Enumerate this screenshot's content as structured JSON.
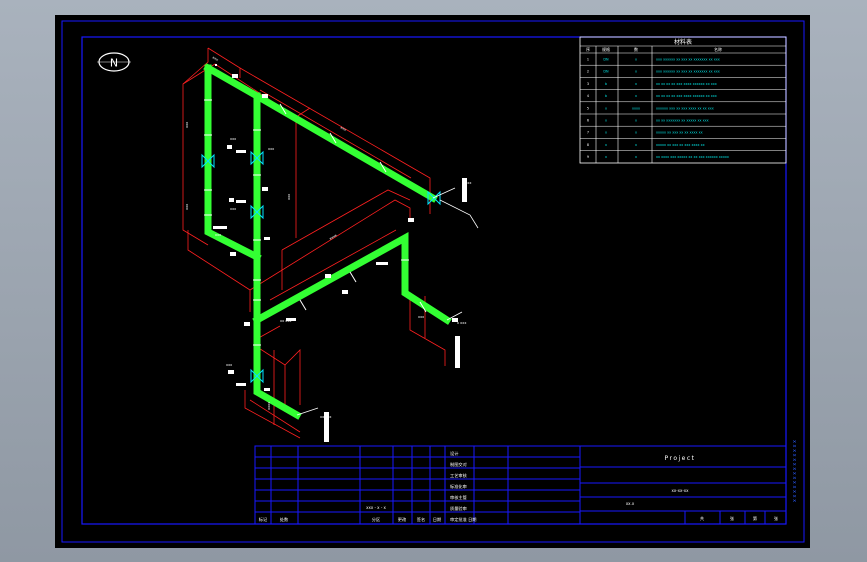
{
  "north_label": "N",
  "colors": {
    "background": "#000000",
    "frame": "#1818ff",
    "pipe": "#33ff33",
    "dimension": "#ff2020",
    "text": "#ffffff",
    "table_text": "#00e5e5",
    "annotation": "#ffffff"
  },
  "parts_table": {
    "title": "材料表",
    "headers": [
      "序",
      "规格",
      "数",
      "名称"
    ],
    "rows": [
      [
        "1",
        "DN",
        "x",
        "xxx xxxxxx xx xxx xx xxxxxxx xx xxx"
      ],
      [
        "2",
        "DN",
        "x",
        "xxx xxxxxx xx xxx xx xxxxxxx xx xxx"
      ],
      [
        "3",
        "b",
        "x",
        "xx xx xx xx xxx xxxx xxxxxx xx xxx"
      ],
      [
        "4",
        "b",
        "x",
        "xx xx xx xx xxx xxxx xxxxxx xx xxx"
      ],
      [
        "5",
        "x",
        "xxxx",
        "xxxxxx xxx xx xxx xxxx xx xx xxx"
      ],
      [
        "6",
        "x",
        "x",
        "xx xx xxxxxxx xx xxxxx xx xxx"
      ],
      [
        "7",
        "x",
        "x",
        "xxxxx xx xxx xx xx xxxx xx"
      ],
      [
        "8",
        "x",
        "x",
        "xxxxx xx xxx xx xxx xxxx xx"
      ],
      [
        "9",
        "x",
        "x",
        "xx xxxx xxx xxxxx xx xx xxx xxxxxx xxxxx"
      ]
    ]
  },
  "title_block": {
    "project_label": "Project",
    "drawing_no": "xx-xx-xx",
    "scale_code": "xx.x",
    "left_labels": [
      "设计",
      "制图交对",
      "工艺审核",
      "标准化审",
      "审核主管",
      "质量验审",
      "审定批准 日期"
    ],
    "bottom_labels": [
      "标记",
      "处数",
      "分区",
      "更改",
      "签名",
      "日期"
    ],
    "mid_text": "xxx - x - x",
    "sheet_labels": [
      "共",
      "张",
      "第",
      "张"
    ]
  },
  "side_text": "x x x x x x x x x x x x x x",
  "annotations": {
    "valve_labels": [
      "xxx",
      "xxx",
      "xxx",
      "xxx",
      "xxx"
    ],
    "end_labels": [
      "x xxx",
      "x xxx",
      "xx xxx",
      "xx xxx"
    ],
    "dim_labels": [
      "xxx",
      "xxx",
      "xxx",
      "xxxx",
      "xxx",
      "xxx",
      "xxxx",
      "xxx"
    ]
  }
}
